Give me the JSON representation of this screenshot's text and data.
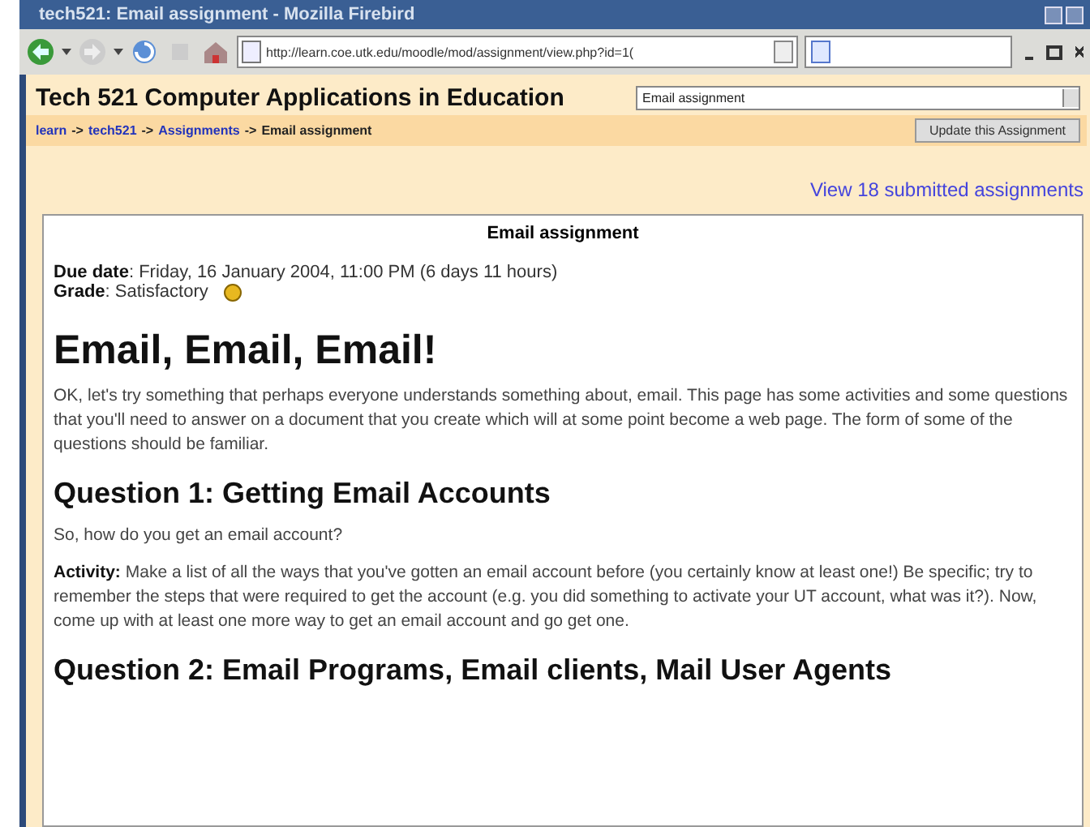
{
  "window": {
    "title": "tech521: Email assignment - Mozilla Firebird"
  },
  "toolbar": {
    "url": "http://learn.coe.utk.edu/moodle/mod/assignment/view.php?id=1("
  },
  "header": {
    "title": "Tech 521 Computer Applications in Education",
    "jump_menu": "Email assignment",
    "update_button": "Update this Assignment"
  },
  "breadcrumb": [
    {
      "label": "learn",
      "kind": "link"
    },
    {
      "label": "->",
      "kind": "sep"
    },
    {
      "label": "tech521",
      "kind": "link"
    },
    {
      "label": "->",
      "kind": "sep"
    },
    {
      "label": "Assignments",
      "kind": "link"
    },
    {
      "label": "->",
      "kind": "sep"
    },
    {
      "label": "Email assignment",
      "kind": "current"
    }
  ],
  "submitted_link": "View 18 submitted assignments",
  "assignment": {
    "heading": "Email assignment",
    "meta": [
      {
        "label": "Due date",
        "value": ": Friday, 16 January 2004, 11:00 PM (6 days 11 hours)"
      },
      {
        "label": "Grade",
        "value": ": Satisfactory",
        "help": true
      }
    ],
    "content": [
      {
        "kind": "h1",
        "text": "Email, Email, Email!"
      },
      {
        "kind": "p",
        "text": "OK, let's try something that perhaps everyone understands something about, email. This page has some activities and some questions that you'll need to answer on a document that you create which will at some point become a web page. The form of some of the questions should be familiar."
      },
      {
        "kind": "h2",
        "text": "Question 1: Getting Email Accounts"
      },
      {
        "kind": "p",
        "text": "So, how do you get an email account?"
      },
      {
        "kind": "p",
        "text": "**Activity:** Make a list of all the ways that you've gotten an email account before (you certainly know at least one!) Be specific; try to remember the steps that were required to get the account (e.g. you did something to activate your UT account, what was it?). Now, come up with at least one more way to get an email account and go get one."
      },
      {
        "kind": "h2",
        "text": "Question 2: Email Programs, Email clients, Mail User Agents"
      }
    ]
  }
}
